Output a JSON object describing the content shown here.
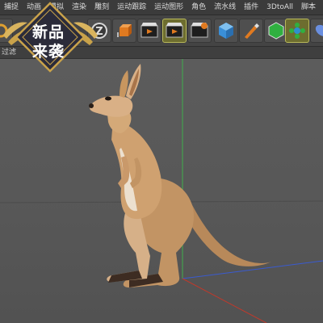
{
  "menubar": {
    "items": [
      {
        "label": "捕捉"
      },
      {
        "label": "动画"
      },
      {
        "label": "模拟"
      },
      {
        "label": "渲染"
      },
      {
        "label": "雕刻"
      },
      {
        "label": "运动跟踪"
      },
      {
        "label": "运动图形"
      },
      {
        "label": "角色"
      },
      {
        "label": "流水线"
      },
      {
        "label": "插件"
      },
      {
        "label": "3DtoAll"
      },
      {
        "label": "脚本"
      }
    ]
  },
  "subbar": {
    "filter_label": "过滤"
  },
  "badge": {
    "line1": "新品",
    "line2": "来袭"
  },
  "toolbar": {
    "icons": [
      "rotate-icon",
      "coordinate-z-icon",
      "axis-object-icon",
      "render-region-icon",
      "render-view-icon",
      "render-settings-icon",
      "cube-icon",
      "pen-icon",
      "subdivision-icon",
      "cloner-icon",
      "deformer-icon"
    ]
  },
  "colors": {
    "menubar": "#3b3b3b",
    "toolbar": "#444444",
    "viewport": "#5a5a5a",
    "axis_green": "#3fae4c",
    "axis_red": "#c0392b",
    "axis_blue": "#3a5bd0",
    "badge_dark": "#2b2b3a",
    "badge_gold": "#c9a24a"
  }
}
